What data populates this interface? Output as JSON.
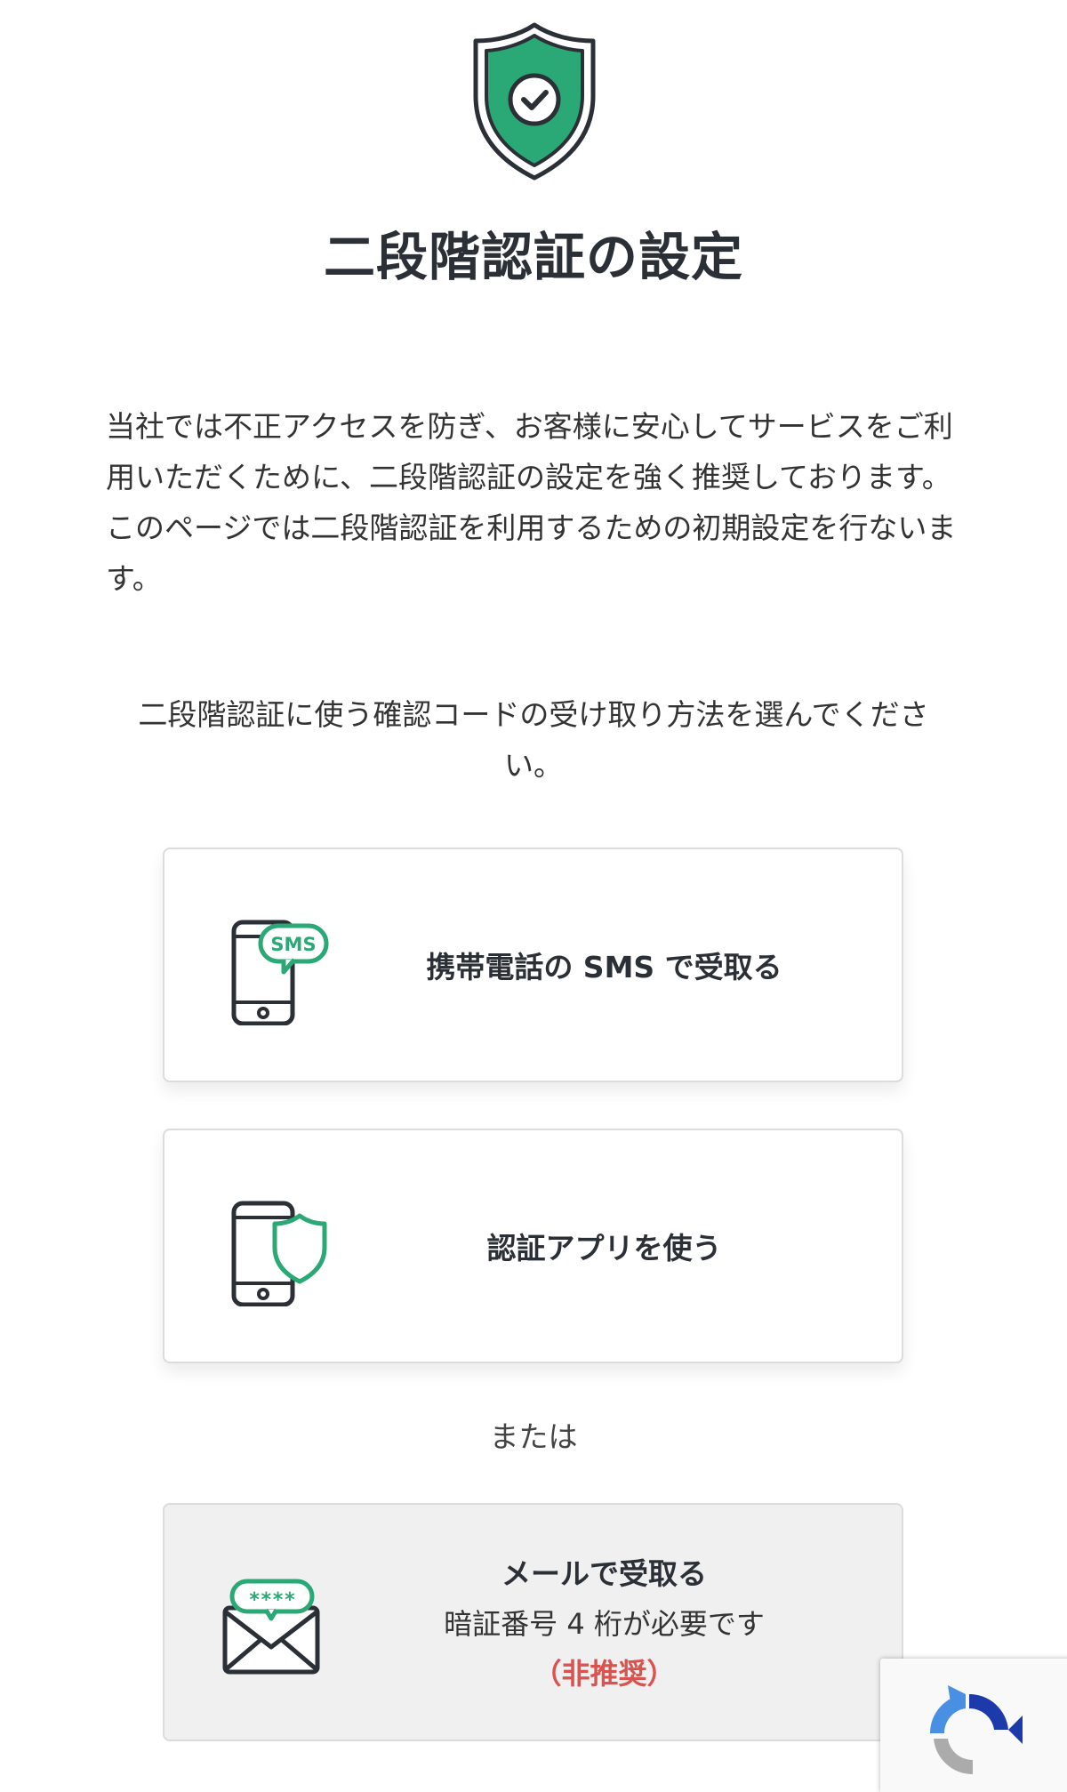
{
  "page": {
    "title": "二段階認証の設定",
    "intro": "当社では不正アクセスを防ぎ、お客様に安心してサービスをご利用いただくために、二段階認証の設定を強く推奨しております。このページでは二段階認証を利用するための初期設定を行ないます。",
    "choose_prompt": "二段階認証に使う確認コードの受け取り方法を選んでください。",
    "or_label": "または"
  },
  "options": {
    "sms": {
      "label": "携帯電話の SMS で受取る",
      "badge": "SMS",
      "icon": "phone-sms-icon"
    },
    "app": {
      "label": "認証アプリを使う",
      "icon": "phone-shield-icon"
    },
    "mail": {
      "label": "メールで受取る",
      "note": "暗証番号 4 桁が必要です",
      "warning": "（非推奨）",
      "code_mask": "****",
      "icon": "envelope-icon"
    }
  },
  "colors": {
    "accent_green": "#2aa876",
    "text_dark": "#2b2f36",
    "warning_red": "#d9534f"
  }
}
